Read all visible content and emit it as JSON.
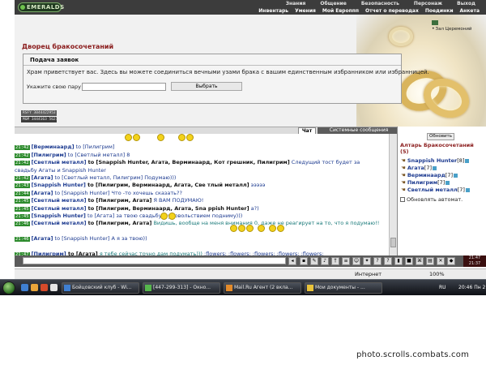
{
  "logo": "EMERALDS",
  "top_menu_row1": [
    "Знания",
    "Общение",
    "Безопасность",
    "Персонаж",
    "Выход"
  ],
  "top_menu_row2": [
    "Инвентарь",
    "Умения",
    "Мой Европпп",
    "Отчет о переводах",
    "Поединки",
    "Анкета"
  ],
  "hall_link": "Зал Церемоний",
  "page_title": "Дворец бракосочетаний",
  "form": {
    "heading": "Подача заявок",
    "welcome": "Храм приветствует вас. Здесь вы можете соединиться вечными узами брака с вашим единственным избранником или избранницей.",
    "partner_label": "Укажите свою пару",
    "partner_value": "",
    "choose_button": "Выбрать"
  },
  "counters": [
    "RSFY 3044422953",
    "MGM 3444163 56215"
  ],
  "tabs": {
    "chat": "Чат",
    "system": "Системные сообщения"
  },
  "chat_lines": [
    {
      "time": "",
      "parts": []
    },
    {
      "time": "21:42",
      "parts": [
        {
          "c": "nm",
          "t": "[Верминаард]"
        },
        {
          "c": "to",
          "t": " to [Пилигрим]"
        }
      ]
    },
    {
      "time": "21:42",
      "parts": [
        {
          "c": "nm",
          "t": "[Пилигрим]"
        },
        {
          "c": "to",
          "t": " to [Светлый металл] 8"
        }
      ]
    },
    {
      "time": "21:42",
      "parts": [
        {
          "c": "nm",
          "t": "[Светлый металл]"
        },
        {
          "c": "bl",
          "t": " to [Snappish Hunter, Агата, Верминаард, Кот грешник, Пилигрим]"
        },
        {
          "c": "msg",
          "t": " Следущий тост будет за"
        }
      ]
    },
    {
      "time": "",
      "parts": [
        {
          "c": "msg",
          "t": "свадьбу Агаты и Snappish Hunter"
        }
      ]
    },
    {
      "time": "21:42",
      "parts": [
        {
          "c": "nm",
          "t": "[Агата]"
        },
        {
          "c": "to",
          "t": " to [Светлый металл, Пилигрим] Подумаю)))"
        }
      ]
    },
    {
      "time": "21:43",
      "parts": [
        {
          "c": "nm",
          "t": "[Snappish Hunter]"
        },
        {
          "c": "bl",
          "t": " to [Пилигрим, Верминаард, Агата, Све тлый металл]"
        },
        {
          "c": "msg",
          "t": " эээээ"
        }
      ]
    },
    {
      "time": "21:44",
      "parts": [
        {
          "c": "nm",
          "t": "[Агата]"
        },
        {
          "c": "to",
          "t": " to [Snappish Hunter] Что -то хочешь сказать??"
        }
      ]
    },
    {
      "time": "21:45",
      "parts": [
        {
          "c": "nm",
          "t": "[Светлый металл]"
        },
        {
          "c": "bl",
          "t": " to [Пилигрим, Агата]"
        },
        {
          "c": "msg",
          "t": " Я ВАМ ПОДУМАЮ!"
        }
      ]
    },
    {
      "time": "21:45",
      "parts": [
        {
          "c": "nm",
          "t": "[Светлый металл]"
        },
        {
          "c": "bl",
          "t": " to [Пилигрим, Верминаард, Агата, Sna ppish Hunter]"
        },
        {
          "c": "msg",
          "t": " а?)"
        }
      ]
    },
    {
      "time": "21:45",
      "parts": [
        {
          "c": "nm",
          "t": "[Snappish Hunter]"
        },
        {
          "c": "to",
          "t": " to [Агата]"
        },
        {
          "c": "msg",
          "t": " за твою свадьбу с удовольствием подниму)))"
        }
      ]
    },
    {
      "time": "21:46",
      "parts": [
        {
          "c": "nm",
          "t": "[Светлый металл]"
        },
        {
          "c": "bl",
          "t": " to [Пилигрим, Агата]"
        },
        {
          "c": "msg2",
          "t": " Видишь, вообще на меня внимания 0, даже не реагирует на то, что я подумаю!!"
        }
      ]
    },
    {
      "time": "",
      "parts": []
    },
    {
      "time": "21:46",
      "parts": [
        {
          "c": "nm",
          "t": "[Агата]"
        },
        {
          "c": "to",
          "t": " to [Snappish Hunter] А я за твою))"
        }
      ]
    },
    {
      "time": "",
      "parts": []
    },
    {
      "time": "21:47",
      "parts": [
        {
          "c": "nm",
          "t": "[Пилигрим]"
        },
        {
          "c": "bl",
          "t": " to [Агата]"
        },
        {
          "c": "msg2",
          "t": " я тебе сейчас точно дам подумать)))"
        },
        {
          "c": "msg",
          "t": "  :flowers:  :flowers:  :flowers:  :flowers:  :flowers:"
        }
      ]
    },
    {
      "time": "",
      "parts": [
        {
          "c": "msg",
          "t": ":flowers:  :flowers:  :flowers:  :flowers:  :flowers:  :flowers:  :flowers:  :flowers:  :flowers:"
        }
      ]
    },
    {
      "time": "21:47",
      "parts": [
        {
          "c": "nm",
          "t": "[Светлый металл]"
        },
        {
          "c": "bl",
          "t": " to [Пилигрим, Агата]"
        },
        {
          "c": "msg",
          "t": " Он празднует нашу свадьбу))"
        }
      ]
    },
    {
      "time": "21:47",
      "parts": [
        {
          "c": "nm",
          "t": "[Агата]"
        },
        {
          "c": "to",
          "t": " to [Пилигрим] Что дашь?)))"
        }
      ]
    }
  ],
  "right_panel": {
    "refresh_button": "Обновить",
    "room_title": "Алтарь Бракосочетаний (5)",
    "users": [
      {
        "name": "Snappish Hunter",
        "level": "[8]"
      },
      {
        "name": "Агата",
        "level": "[7]"
      },
      {
        "name": "Верминаард",
        "level": "[7]"
      },
      {
        "name": "Пилигрим",
        "level": "[7]"
      },
      {
        "name": "Светлый металл",
        "level": "[7]"
      }
    ],
    "auto_update": "Обновлять автомат."
  },
  "clock_small": "21:47 21:37",
  "status_bar": {
    "zone": "Интернет",
    "zoom": "100%"
  },
  "taskbar": {
    "tasks": [
      "Бойцовский клуб - Wi...",
      "[447-299-313] - Окно...",
      "Mail.Ru Агент (2 вкла...",
      "Мои документы - ..."
    ],
    "lang": "RU",
    "time": "20:46 Пн 2"
  },
  "watermark": "photo.scrolls.combats.com"
}
